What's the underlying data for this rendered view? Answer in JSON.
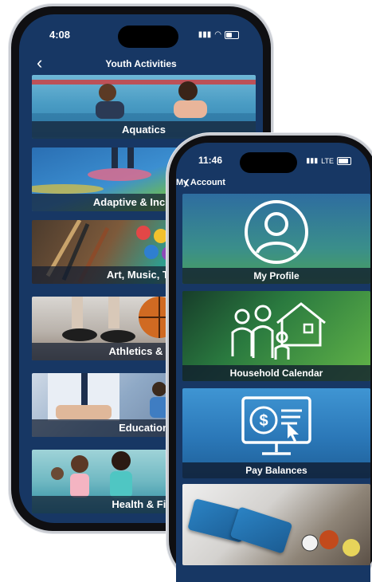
{
  "phone1": {
    "time": "4:08",
    "title": "Youth Activities",
    "back": "‹",
    "tiles": [
      {
        "label": "Aquatics"
      },
      {
        "label": "Adaptive & Inclusive"
      },
      {
        "label": "Art, Music, The"
      },
      {
        "label": "Athletics & Sp"
      },
      {
        "label": "Education"
      },
      {
        "label": "Health & Fitn"
      }
    ]
  },
  "phone2": {
    "time": "11:46",
    "network": "LTE",
    "title": "My Account",
    "back": "‹",
    "tiles": [
      {
        "label": "My Profile",
        "icon": "user-profile-icon"
      },
      {
        "label": "Household Calendar",
        "icon": "family-house-icon"
      },
      {
        "label": "Pay Balances",
        "icon": "payment-screen-icon"
      }
    ]
  },
  "colors": {
    "app_background": "#173764",
    "label_bar": "#14203a",
    "icon_stroke": "#ffffff"
  }
}
